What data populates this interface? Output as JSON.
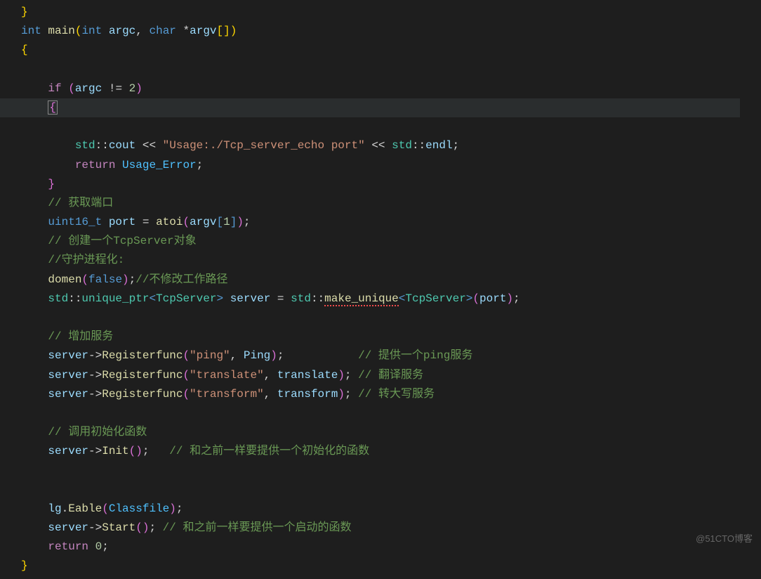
{
  "code": {
    "line0": "}",
    "line1": {
      "int": "int",
      "main": "main",
      "int2": "int",
      "argc": "argc",
      "char": "char",
      "argv": "argv"
    },
    "line2": "{",
    "line3_blank": "",
    "line4": {
      "if": "if",
      "argc": "argc",
      "neq": "!=",
      "two": "2"
    },
    "line5": "{",
    "line6": {
      "std": "std",
      "cout": "cout",
      "op": "<<",
      "str": "\"Usage:./Tcp_server_echo port\"",
      "op2": "<<",
      "std2": "std",
      "endl": "endl"
    },
    "line7": {
      "return": "return",
      "usage": "Usage_Error"
    },
    "line8": "}",
    "line9": "// 获取端口",
    "line10": {
      "type": "uint16_t",
      "port": "port",
      "atoi": "atoi",
      "argv": "argv",
      "one": "1"
    },
    "line11": "// 创建一个TcpServer对象",
    "line12": "//守护进程化:",
    "line13": {
      "domen": "domen",
      "false": "false",
      "comment": "//不修改工作路径"
    },
    "line14": {
      "std": "std",
      "unique_ptr": "unique_ptr",
      "tcp": "TcpServer",
      "server": "server",
      "std2": "std",
      "make_unique": "make_unique",
      "tcp2": "TcpServer",
      "port": "port"
    },
    "line15_blank": "",
    "line16": "// 增加服务",
    "line17": {
      "server": "server",
      "register": "Registerfunc",
      "str": "\"ping\"",
      "ping": "Ping",
      "comment": "// 提供一个ping服务"
    },
    "line18": {
      "server": "server",
      "register": "Registerfunc",
      "str": "\"translate\"",
      "translate": "translate",
      "comment": "// 翻译服务"
    },
    "line19": {
      "server": "server",
      "register": "Registerfunc",
      "str": "\"transform\"",
      "transform": "transform",
      "comment": "// 转大写服务"
    },
    "line20_blank": "",
    "line21": "// 调用初始化函数",
    "line22": {
      "server": "server",
      "init": "Init",
      "comment": "// 和之前一样要提供一个初始化的函数"
    },
    "line23_blank": "",
    "line24_blank": "",
    "line25": {
      "lg": "lg",
      "eable": "Eable",
      "classfile": "Classfile"
    },
    "line26": {
      "server": "server",
      "start": "Start",
      "comment": "// 和之前一样要提供一个启动的函数"
    },
    "line27": {
      "return": "return",
      "zero": "0"
    },
    "line28": "}"
  },
  "watermark": "@51CTO博客"
}
